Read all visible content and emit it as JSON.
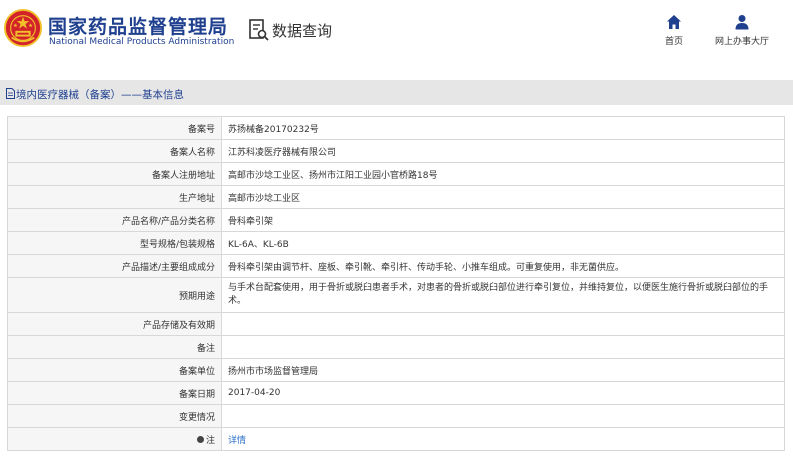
{
  "header": {
    "title_cn": "国家药品监督管理局",
    "title_en": "National Medical Products Administration",
    "query_label": "数据查询",
    "nav": {
      "home_label": "首页",
      "hall_label": "网上办事大厅"
    }
  },
  "section": {
    "title": "境内医疗器械（备案）——基本信息"
  },
  "rows": [
    {
      "label": "备案号",
      "value": "苏扬械备20170232号"
    },
    {
      "label": "备案人名称",
      "value": "江苏科凌医疗器械有限公司"
    },
    {
      "label": "备案人注册地址",
      "value": "高邮市沙埝工业区、扬州市江阳工业园小官桥路18号"
    },
    {
      "label": "生产地址",
      "value": "高邮市沙埝工业区"
    },
    {
      "label": "产品名称/产品分类名称",
      "value": "骨科牵引架"
    },
    {
      "label": "型号规格/包装规格",
      "value": "KL-6A、KL-6B"
    },
    {
      "label": "产品描述/主要组成成分",
      "value": "骨科牵引架由调节杆、座板、牵引靴、牵引杆、传动手轮、小推车组成。可重复使用，非无菌供应。"
    },
    {
      "label": "预期用途",
      "value": "与手术台配套使用，用于骨折或脱臼患者手术，对患者的骨折或脱臼部位进行牵引复位，并维持复位，以便医生施行骨折或脱臼部位的手术。"
    },
    {
      "label": "产品存储及有效期",
      "value": ""
    },
    {
      "label": "备注",
      "value": ""
    },
    {
      "label": "备案单位",
      "value": "扬州市市场监督管理局"
    },
    {
      "label": "备案日期",
      "value": "2017-04-20"
    },
    {
      "label": "变更情况",
      "value": ""
    },
    {
      "label": "注",
      "value": "详情"
    }
  ],
  "colors": {
    "brand_blue": "#1f3f8f",
    "link_blue": "#2a6fc9",
    "emblem_red": "#d2232a",
    "emblem_gold": "#f2c029"
  },
  "icons": {
    "emblem": "national-emblem-icon",
    "query": "document-search-icon",
    "home": "home-icon",
    "hall": "user-icon",
    "section": "document-icon",
    "note": "pin-icon"
  }
}
